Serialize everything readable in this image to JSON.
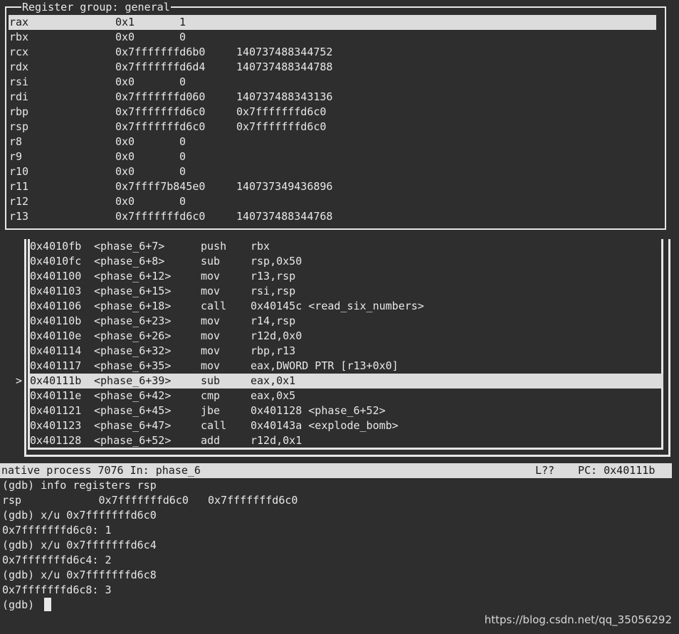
{
  "register_window": {
    "title": "Register group: general",
    "rows": [
      {
        "name": "rax",
        "hex": "0x1",
        "val": "1",
        "wide": false,
        "selected": true
      },
      {
        "name": "rbx",
        "hex": "0x0",
        "val": "0",
        "wide": false
      },
      {
        "name": "rcx",
        "hex": "0x7fffffffd6b0",
        "val": "140737488344752",
        "wide": true
      },
      {
        "name": "rdx",
        "hex": "0x7fffffffd6d4",
        "val": "140737488344788",
        "wide": true
      },
      {
        "name": "rsi",
        "hex": "0x0",
        "val": "0",
        "wide": false
      },
      {
        "name": "rdi",
        "hex": "0x7fffffffd060",
        "val": "140737488343136",
        "wide": true
      },
      {
        "name": "rbp",
        "hex": "0x7fffffffd6c0",
        "val": "0x7fffffffd6c0",
        "wide": true
      },
      {
        "name": "rsp",
        "hex": "0x7fffffffd6c0",
        "val": "0x7fffffffd6c0",
        "wide": true
      },
      {
        "name": "r8",
        "hex": "0x0",
        "val": "0",
        "wide": false
      },
      {
        "name": "r9",
        "hex": "0x0",
        "val": "0",
        "wide": false
      },
      {
        "name": "r10",
        "hex": "0x0",
        "val": "0",
        "wide": false
      },
      {
        "name": "r11",
        "hex": "0x7ffff7b845e0",
        "val": "140737349436896",
        "wide": true
      },
      {
        "name": "r12",
        "hex": "0x0",
        "val": "0",
        "wide": false
      },
      {
        "name": "r13",
        "hex": "0x7fffffffd6c0",
        "val": "140737488344768",
        "wide": true
      }
    ]
  },
  "asm_window": {
    "pc_marker": ">",
    "rows": [
      {
        "addr": "0x4010fb",
        "sym": "<phase_6+7>",
        "op": "push",
        "args": "rbx"
      },
      {
        "addr": "0x4010fc",
        "sym": "<phase_6+8>",
        "op": "sub",
        "args": "rsp,0x50"
      },
      {
        "addr": "0x401100",
        "sym": "<phase_6+12>",
        "op": "mov",
        "args": "r13,rsp"
      },
      {
        "addr": "0x401103",
        "sym": "<phase_6+15>",
        "op": "mov",
        "args": "rsi,rsp"
      },
      {
        "addr": "0x401106",
        "sym": "<phase_6+18>",
        "op": "call",
        "args": "0x40145c <read_six_numbers>"
      },
      {
        "addr": "0x40110b",
        "sym": "<phase_6+23>",
        "op": "mov",
        "args": "r14,rsp"
      },
      {
        "addr": "0x40110e",
        "sym": "<phase_6+26>",
        "op": "mov",
        "args": "r12d,0x0"
      },
      {
        "addr": "0x401114",
        "sym": "<phase_6+32>",
        "op": "mov",
        "args": "rbp,r13"
      },
      {
        "addr": "0x401117",
        "sym": "<phase_6+35>",
        "op": "mov",
        "args": "eax,DWORD PTR [r13+0x0]"
      },
      {
        "addr": "0x40111b",
        "sym": "<phase_6+39>",
        "op": "sub",
        "args": "eax,0x1",
        "current": true
      },
      {
        "addr": "0x40111e",
        "sym": "<phase_6+42>",
        "op": "cmp",
        "args": "eax,0x5"
      },
      {
        "addr": "0x401121",
        "sym": "<phase_6+45>",
        "op": "jbe",
        "args": "0x401128 <phase_6+52>"
      },
      {
        "addr": "0x401123",
        "sym": "<phase_6+47>",
        "op": "call",
        "args": "0x40143a <explode_bomb>"
      },
      {
        "addr": "0x401128",
        "sym": "<phase_6+52>",
        "op": "add",
        "args": "r12d,0x1"
      }
    ]
  },
  "status_bar": {
    "process": "native process 7076 In: phase_6",
    "line": "L??",
    "pc": "PC: 0x40111b"
  },
  "console": {
    "lines": [
      {
        "text": "(gdb) info registers rsp"
      },
      {
        "text": "rsp            0x7fffffffd6c0   0x7fffffffd6c0"
      },
      {
        "text": "(gdb) x/u 0x7fffffffd6c0"
      },
      {
        "text": "0x7fffffffd6c0: 1"
      },
      {
        "text": "(gdb) x/u 0x7fffffffd6c4"
      },
      {
        "text": "0x7fffffffd6c4: 2"
      },
      {
        "text": "(gdb) x/u 0x7fffffffd6c8"
      },
      {
        "text": "0x7fffffffd6c8: 3"
      },
      {
        "text": "(gdb) "
      }
    ],
    "prompt": "(gdb)"
  },
  "watermark": "https://blog.csdn.net/qq_35056292"
}
